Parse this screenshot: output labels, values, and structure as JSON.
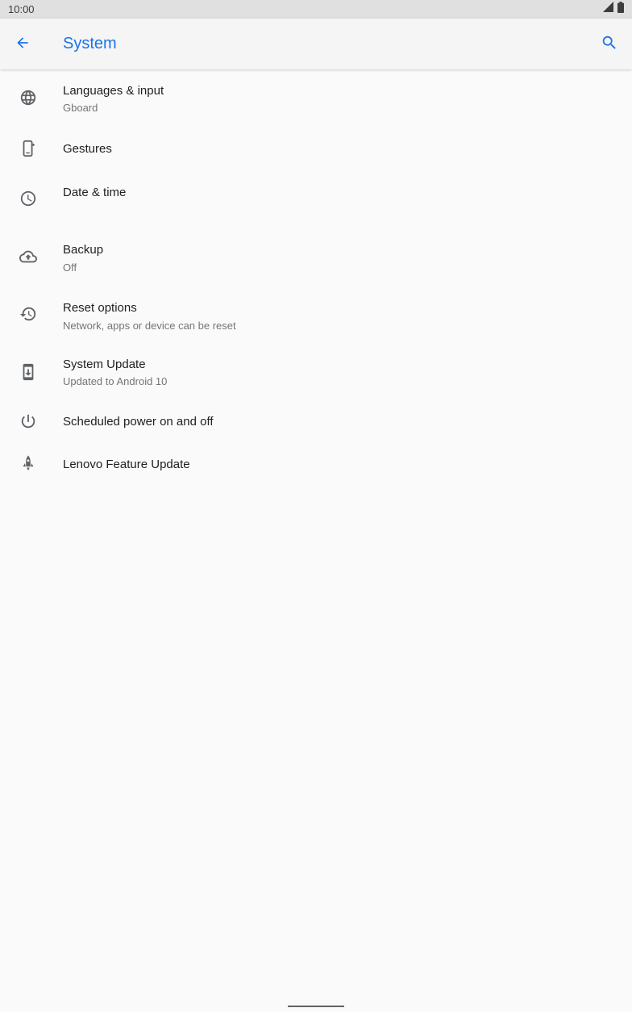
{
  "status_bar": {
    "time": "10:00",
    "icons": [
      "cell-signal-icon",
      "battery-icon"
    ]
  },
  "app_bar": {
    "back_icon": "arrow-back-icon",
    "title": "System",
    "search_icon": "search-icon"
  },
  "items": [
    {
      "icon": "globe-icon",
      "title": "Languages & input",
      "subtitle": "Gboard"
    },
    {
      "icon": "gestures-icon",
      "title": "Gestures",
      "subtitle": ""
    },
    {
      "icon": "clock-icon",
      "title": "Date & time",
      "subtitle": ""
    },
    {
      "icon": "cloud-upload-icon",
      "title": "Backup",
      "subtitle": "Off"
    },
    {
      "icon": "history-icon",
      "title": "Reset options",
      "subtitle": "Network, apps or device can be reset"
    },
    {
      "icon": "system-update-icon",
      "title": "System Update",
      "subtitle": "Updated to Android 10"
    },
    {
      "icon": "power-icon",
      "title": "Scheduled power on and off",
      "subtitle": ""
    },
    {
      "icon": "rocket-icon",
      "title": "Lenovo Feature Update",
      "subtitle": ""
    }
  ],
  "colors": {
    "accent": "#1a73e8",
    "icon": "#5f6368",
    "title_text": "#202124",
    "subtitle_text": "#757575",
    "background": "#fafafa",
    "app_bar": "#f5f5f5",
    "status_bar": "#e0e0e0"
  }
}
